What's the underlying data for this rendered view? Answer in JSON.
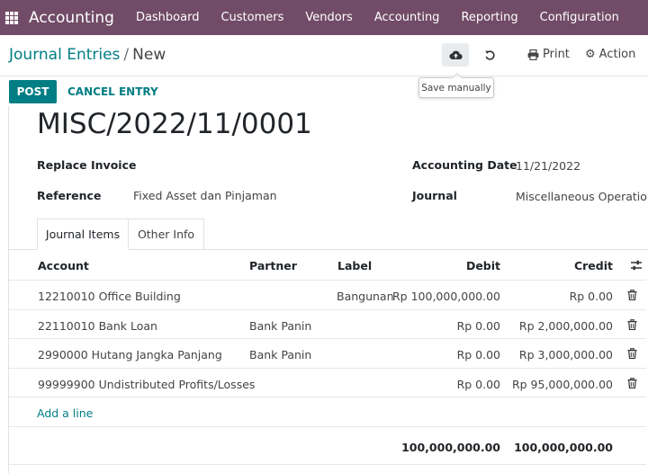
{
  "navbar": {
    "app_name": "Accounting",
    "menu": [
      "Dashboard",
      "Customers",
      "Vendors",
      "Accounting",
      "Reporting",
      "Configuration"
    ]
  },
  "breadcrumb": {
    "parent": "Journal Entries",
    "separator": "/",
    "current": "New"
  },
  "control_panel": {
    "save_tooltip": "Save manually",
    "print_label": "Print",
    "action_label": "Action"
  },
  "statusbar": {
    "post_label": "POST",
    "cancel_label": "CANCEL ENTRY"
  },
  "form": {
    "name": "MISC/2022/11/0001",
    "replace_invoice_label": "Replace Invoice",
    "reference_label": "Reference",
    "reference_value": "Fixed Asset dan Pinjaman",
    "accounting_date_label": "Accounting Date",
    "accounting_date_value": "11/21/2022",
    "journal_label": "Journal",
    "journal_value": "Miscellaneous Operations"
  },
  "tabs": [
    "Journal Items",
    "Other Info"
  ],
  "table": {
    "headers": {
      "account": "Account",
      "partner": "Partner",
      "label": "Label",
      "debit": "Debit",
      "credit": "Credit"
    },
    "rows": [
      {
        "account": "12210010 Office Building",
        "partner": "",
        "label": "Bangunan",
        "debit": "Rp 100,000,000.00",
        "credit": "Rp 0.00"
      },
      {
        "account": "22110010 Bank Loan",
        "partner": "Bank Panin",
        "label": "",
        "debit": "Rp 0.00",
        "credit": "Rp 2,000,000.00"
      },
      {
        "account": "2990000 Hutang Jangka Panjang",
        "partner": "Bank Panin",
        "label": "",
        "debit": "Rp 0.00",
        "credit": "Rp 3,000,000.00"
      },
      {
        "account": "99999900 Undistributed Profits/Losses",
        "partner": "",
        "label": "",
        "debit": "Rp 0.00",
        "credit": "Rp 95,000,000.00"
      }
    ],
    "add_line": "Add a line",
    "total_debit": "100,000,000.00",
    "total_credit": "100,000,000.00"
  },
  "colors": {
    "navbar": "#714B67",
    "primary": "#017e84"
  }
}
